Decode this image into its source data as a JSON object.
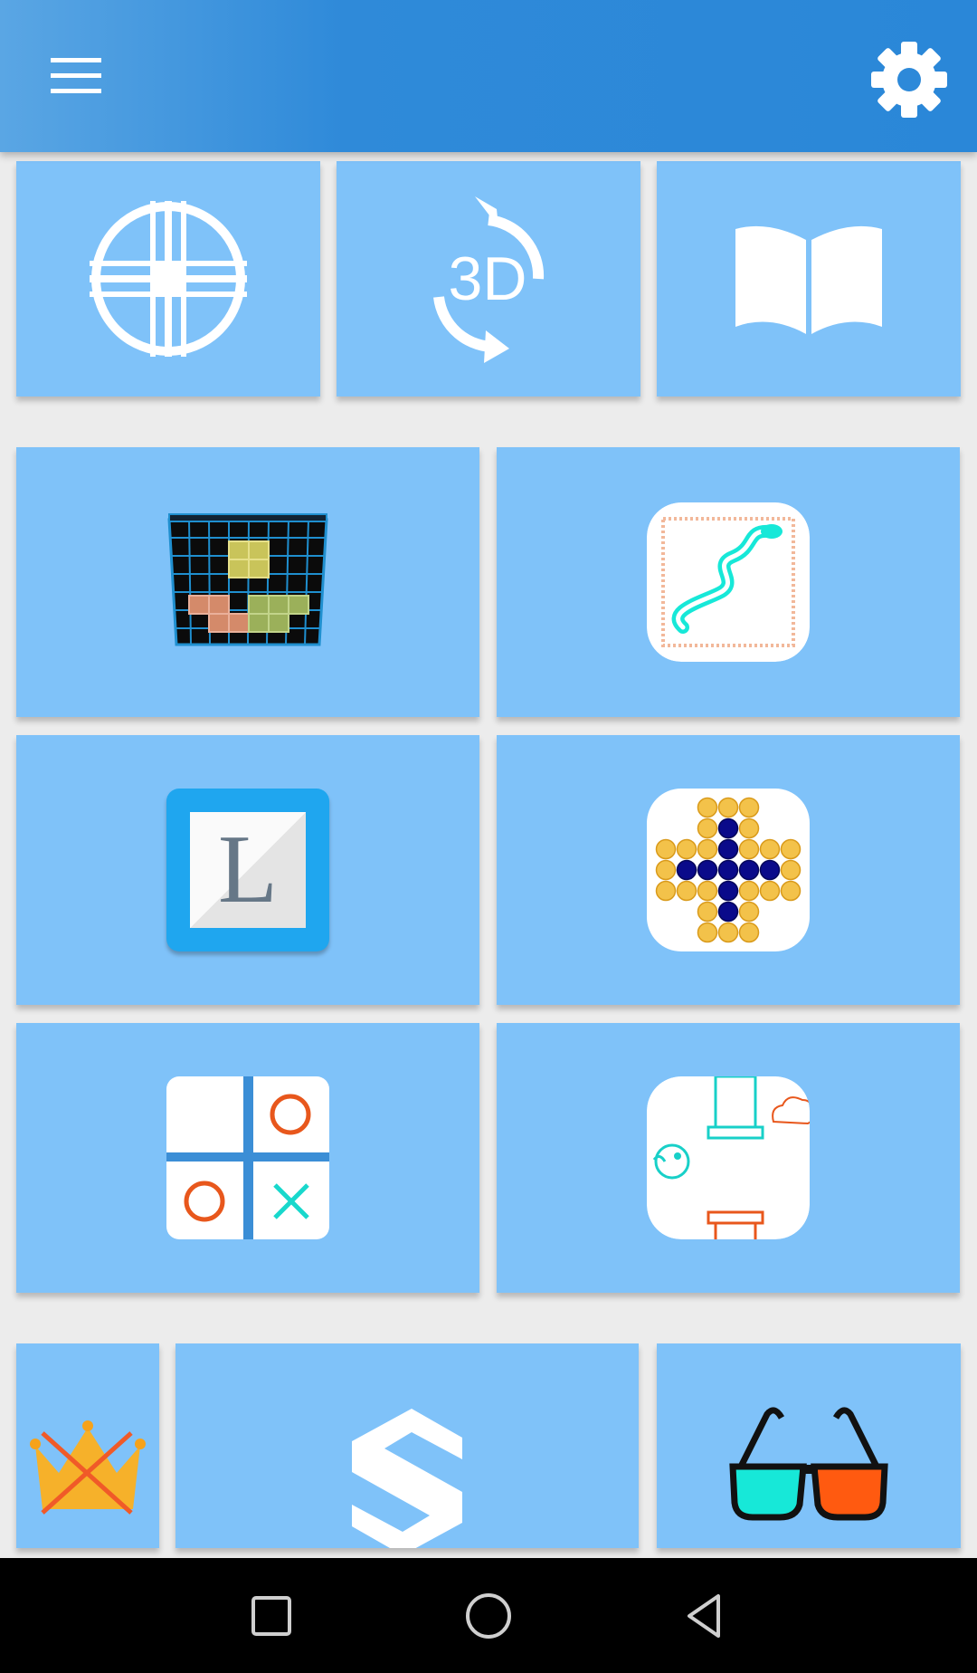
{
  "app_bar": {
    "menu_icon": "hamburger-menu-icon",
    "settings_icon": "gear-icon",
    "gradient_colors": [
      "#5aa6e4",
      "#2a87d8"
    ]
  },
  "tiles_row1": [
    {
      "name": "crosshair-target-tile",
      "icon": "crosshair-icon"
    },
    {
      "name": "rotate-3d-tile",
      "icon": "rotate-3d-icon",
      "text": "3D"
    },
    {
      "name": "book-tile",
      "icon": "open-book-icon"
    }
  ],
  "game_tiles": [
    {
      "name": "block-puzzle-game-tile",
      "icon": "block-puzzle-icon"
    },
    {
      "name": "snake-game-tile",
      "icon": "snake-icon"
    },
    {
      "name": "word-game-tile",
      "icon": "letter-l-icon",
      "text": "L"
    },
    {
      "name": "peg-solitaire-game-tile",
      "icon": "peg-solitaire-icon"
    },
    {
      "name": "tic-tac-toe-game-tile",
      "icon": "tic-tac-toe-icon"
    },
    {
      "name": "flappy-bird-game-tile",
      "icon": "flappy-bird-icon"
    }
  ],
  "tiles_row5": [
    {
      "name": "no-ads-tile",
      "icon": "crossed-crown-icon"
    },
    {
      "name": "s-logo-tile",
      "icon": "s-logo-icon"
    },
    {
      "name": "3d-glasses-tile",
      "icon": "3d-glasses-icon"
    }
  ],
  "nav_bar": {
    "recents_icon": "square-recents-icon",
    "home_icon": "circle-home-icon",
    "back_icon": "triangle-back-icon"
  },
  "colors": {
    "tile": "#7fc2f9",
    "background": "#ececec",
    "accent": "#2a87d8"
  }
}
